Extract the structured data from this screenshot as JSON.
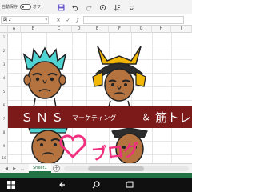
{
  "quick_access": {
    "autosave_label": "自動保存",
    "autosave_state": "オフ",
    "tools": [
      {
        "name": "save-icon"
      },
      {
        "name": "undo-icon"
      },
      {
        "name": "redo-icon"
      },
      {
        "name": "touch-mode-icon"
      },
      {
        "name": "sort-icon"
      },
      {
        "name": "customize-icon"
      }
    ]
  },
  "formula_bar": {
    "name_box": "図 2",
    "formula_value": ""
  },
  "columns": [
    "A",
    "B",
    "C",
    "D",
    "E",
    "F",
    "G",
    "H",
    "I"
  ],
  "rows": [
    "1",
    "2",
    "3",
    "4",
    "5",
    "6",
    "7",
    "8",
    "9",
    "10"
  ],
  "artwork": {
    "banner_sns": "ＳＮＳ",
    "banner_marketing": "マーケティング",
    "banner_amp": "＆",
    "banner_kintore": "筋トレ",
    "blog_text": "ブログ",
    "banner_color": "#7c1a1a",
    "heart_color": "#f0307f"
  },
  "sheet_tabs": {
    "active_tab": "Sheet1",
    "add_symbol": "+"
  },
  "colors": {
    "excel_green": "#217346",
    "taskbar": "#101010"
  }
}
